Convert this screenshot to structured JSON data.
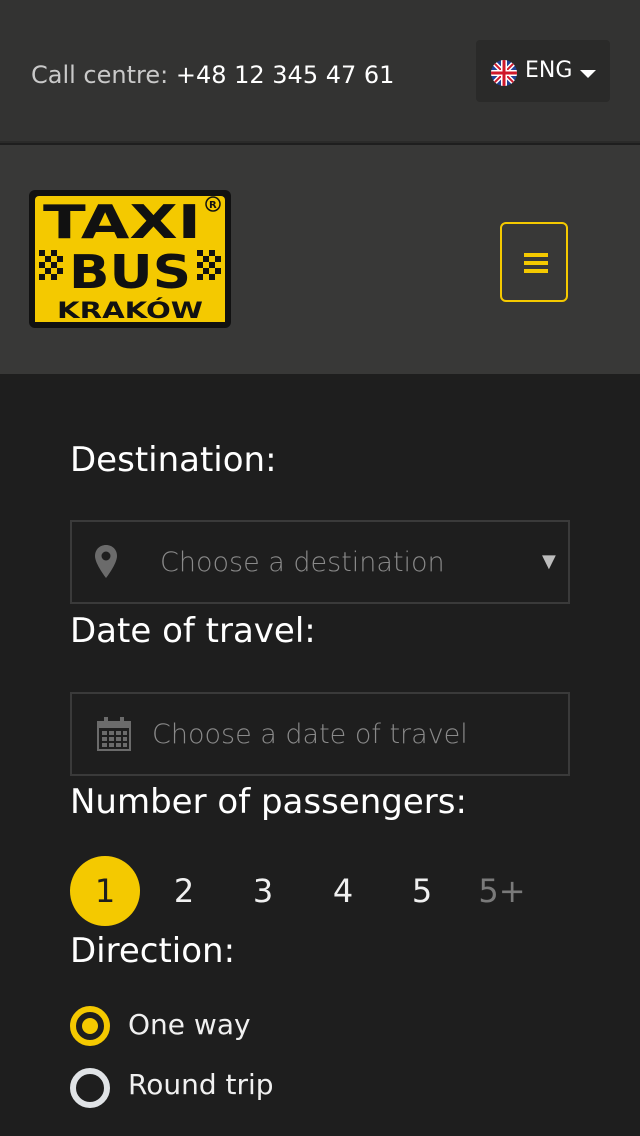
{
  "topbar": {
    "call_label": "Call centre:",
    "phone": "+48 12 345 47 61",
    "language": "ENG",
    "language_flag_icon": "uk-flag-icon",
    "language_caret_icon": "caret-down-icon"
  },
  "header": {
    "logo": {
      "line1": "TAXI",
      "line2": "BUS",
      "line3": "KRAKÓW",
      "registered": "®"
    },
    "menu_icon": "hamburger-icon"
  },
  "colors": {
    "accent": "#f4c900",
    "topbar_bg": "#333332",
    "header_bg": "#383837",
    "body_bg": "#1e1e1e"
  },
  "form": {
    "destination": {
      "label": "Destination:",
      "placeholder": "Choose a destination",
      "icon": "map-pin-icon",
      "dropdown_icon": "triangle-down-icon"
    },
    "date": {
      "label": "Date of travel:",
      "placeholder": "Choose a date of travel",
      "icon": "calendar-icon"
    },
    "passengers": {
      "label": "Number of passengers:",
      "options": [
        "1",
        "2",
        "3",
        "4",
        "5",
        "5+"
      ],
      "selected": "1"
    },
    "direction": {
      "label": "Direction:",
      "options": [
        "One way",
        "Round trip"
      ],
      "selected": "One way"
    }
  }
}
